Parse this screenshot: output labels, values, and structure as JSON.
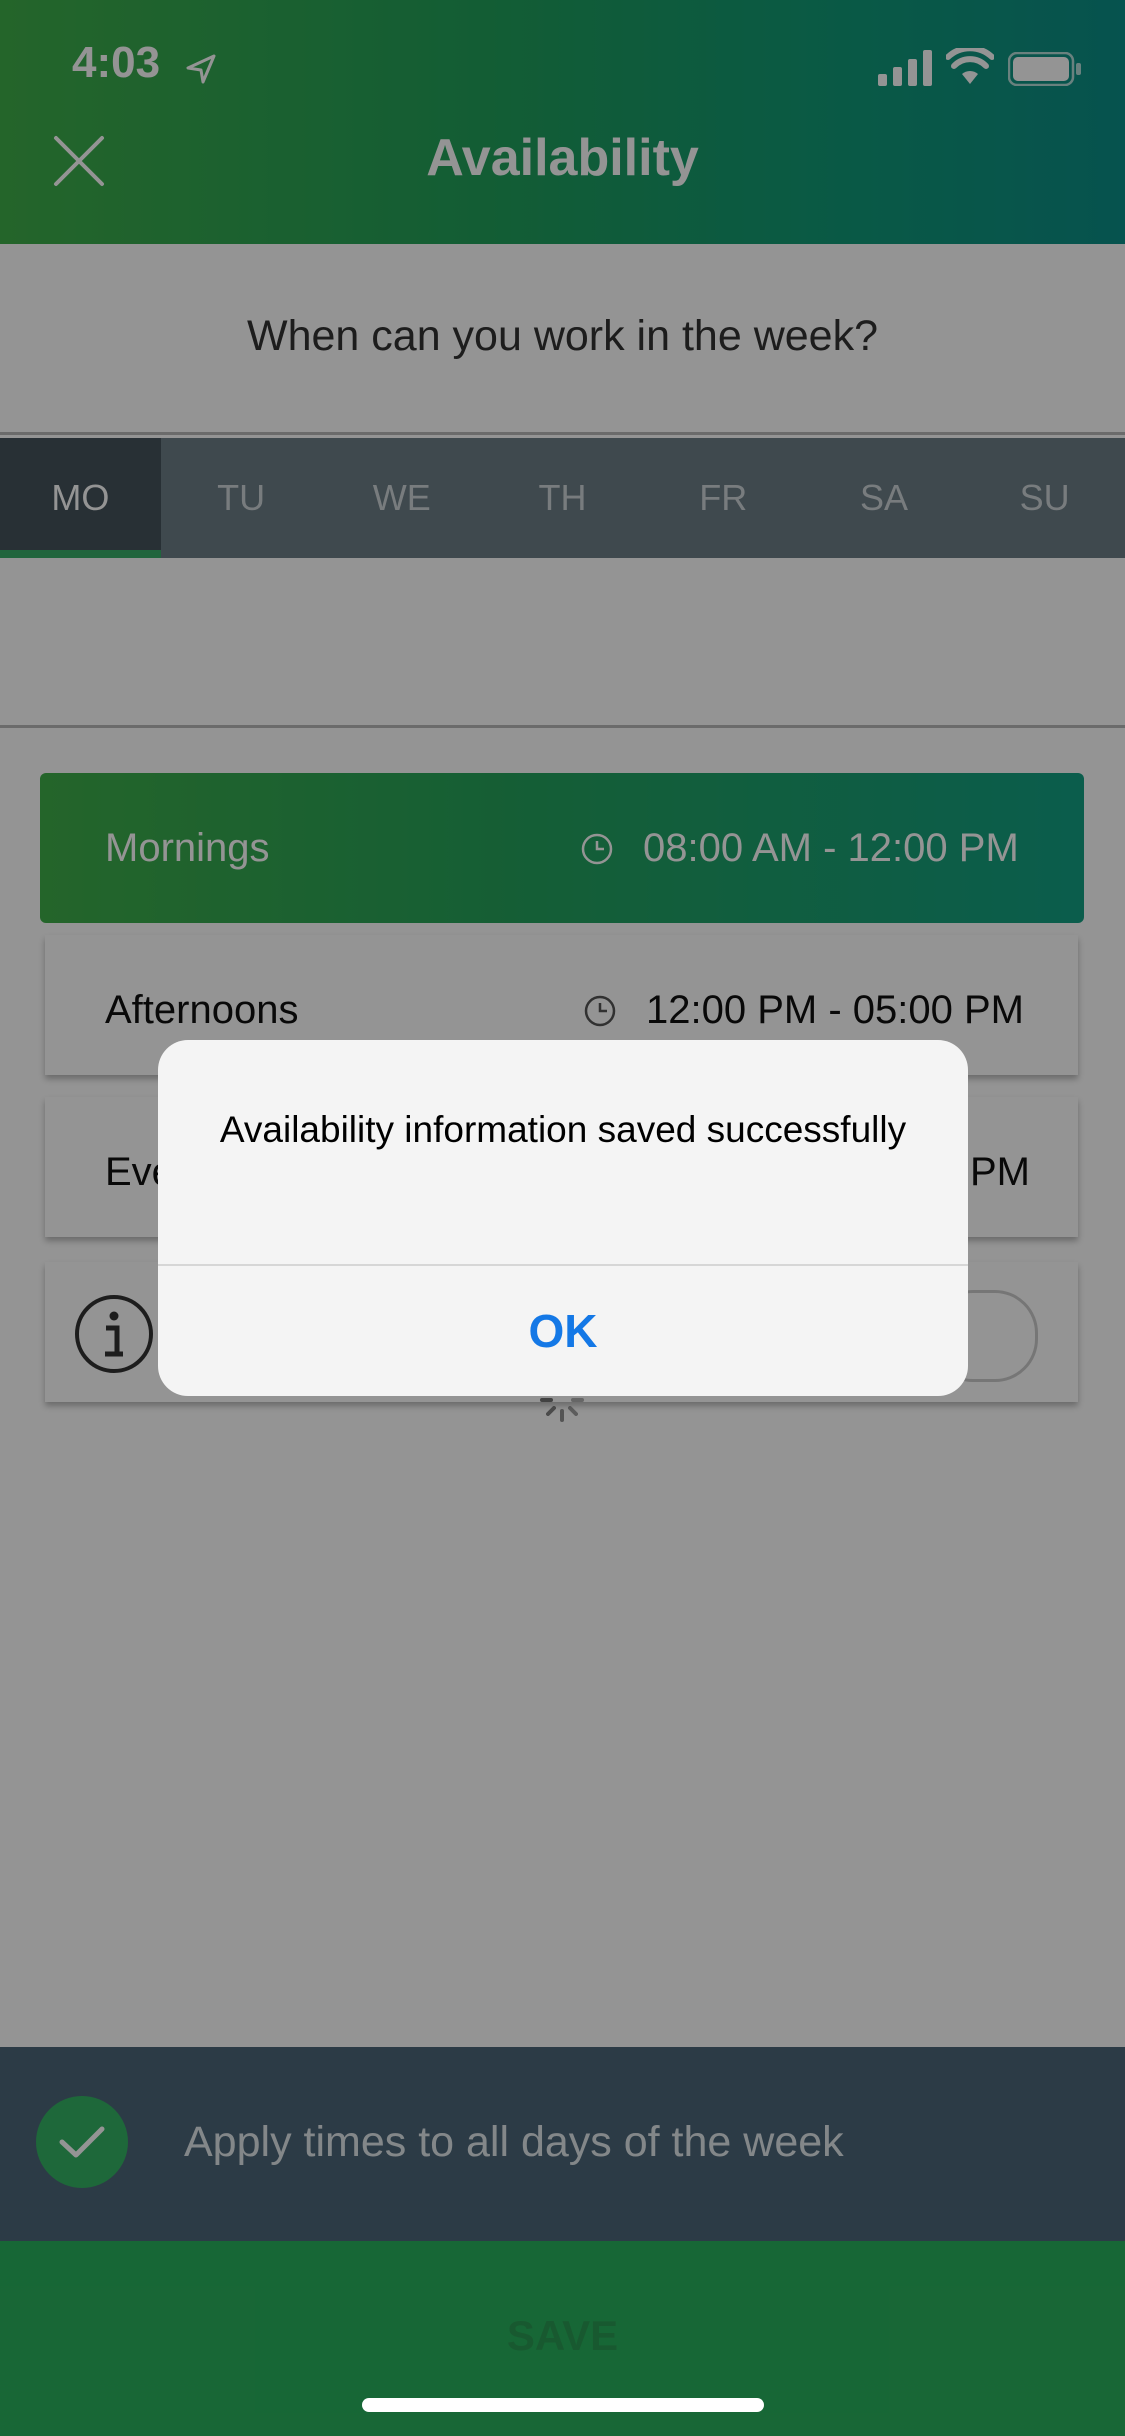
{
  "status_bar": {
    "time": "4:03"
  },
  "header": {
    "title": "Availability"
  },
  "question": "When can you work in the week?",
  "days": [
    "MO",
    "TU",
    "WE",
    "TH",
    "FR",
    "SA",
    "SU"
  ],
  "selected_day": "MO",
  "slots": [
    {
      "label": "Mornings",
      "time": "08:00 AM - 12:00 PM",
      "selected": true
    },
    {
      "label": "Afternoons",
      "time": "12:00 PM - 05:00 PM",
      "selected": false
    },
    {
      "label": "Eve",
      "time": "PM",
      "selected": false
    }
  ],
  "apply_all": {
    "label": "Apply times to all days of the week",
    "checked": true
  },
  "save_label": "SAVE",
  "alert": {
    "message": "Availability information saved successfully",
    "button": "OK"
  },
  "colors": {
    "accent_green": "#29b25d",
    "ios_blue": "#1478e6"
  }
}
